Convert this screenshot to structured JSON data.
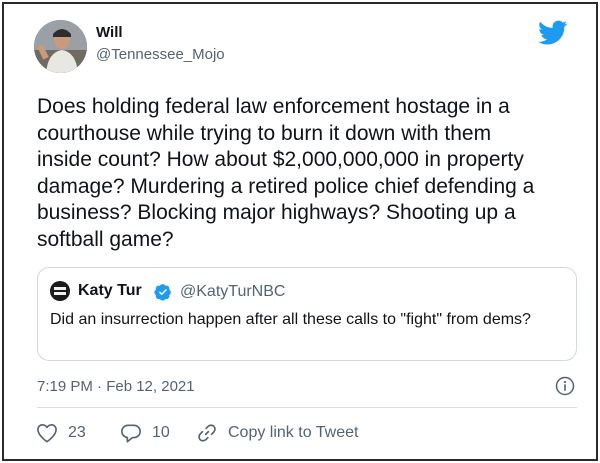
{
  "author": {
    "display_name": "Will",
    "handle": "@Tennessee_Mojo"
  },
  "tweet": {
    "text": "Does holding federal law enforcement hostage in a\ncourthouse while trying to burn it down with them\ninside count? How about $2,000,000,000 in property\ndamage? Murdering a retired police chief defending a\nbusiness? Blocking major highways? Shooting up a\nsoftball game?"
  },
  "quoted_tweet": {
    "display_name": "Katy Tur",
    "handle": "@KatyTurNBC",
    "verified": true,
    "text": "Did an insurrection happen after all these calls to \"fight\" from dems?"
  },
  "meta": {
    "timestamp": "7:19 PM · Feb 12, 2021"
  },
  "actions": {
    "likes": "23",
    "replies": "10",
    "copy_link_label": "Copy link to Tweet"
  },
  "colors": {
    "brand_blue": "#1d9bf0",
    "text_primary": "#0f1419",
    "text_secondary": "#536471",
    "border": "#cfd9de"
  },
  "icons": {
    "brand": "twitter-bird-icon",
    "verified": "verified-badge-icon",
    "info": "info-icon",
    "like": "heart-icon",
    "reply": "comment-icon",
    "copy_link": "link-icon"
  }
}
